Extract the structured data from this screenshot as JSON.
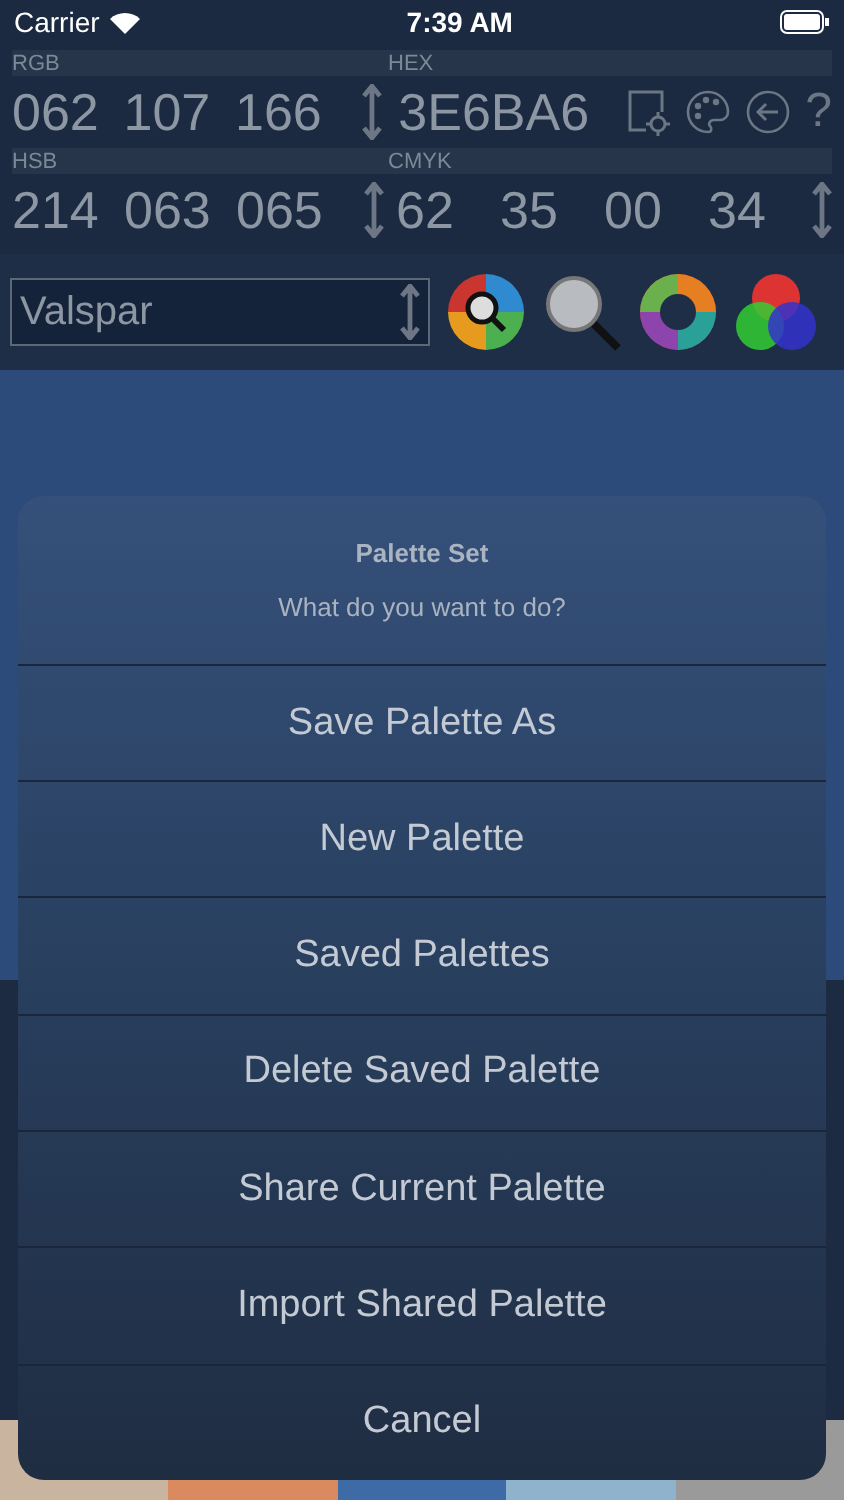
{
  "status_bar": {
    "carrier": "Carrier",
    "time": "7:39 AM"
  },
  "color_values": {
    "rgb": {
      "label": "RGB",
      "values": [
        "062",
        "107",
        "166"
      ]
    },
    "hex": {
      "label": "HEX",
      "value": "3E6BA6"
    },
    "help": "?",
    "hsb": {
      "label": "HSB",
      "values": [
        "214",
        "063",
        "065"
      ]
    },
    "cmyk": {
      "label": "CMYK",
      "values": [
        "62",
        "35",
        "00",
        "34"
      ]
    }
  },
  "palette_selector": {
    "value": "Valspar"
  },
  "swatches": [
    {
      "color": "#c9b49f"
    },
    {
      "color": "#d98a5e"
    },
    {
      "color": "#3e6ba6"
    },
    {
      "color": "#8fb3cc"
    },
    {
      "color": "#9a9a9a"
    }
  ],
  "action_sheet": {
    "title": "Palette Set",
    "message": "What do you want to do?",
    "actions": [
      "Save Palette As",
      "New Palette",
      "Saved Palettes",
      "Delete Saved Palette",
      "Share Current Palette",
      "Import Shared Palette"
    ],
    "cancel": "Cancel"
  }
}
